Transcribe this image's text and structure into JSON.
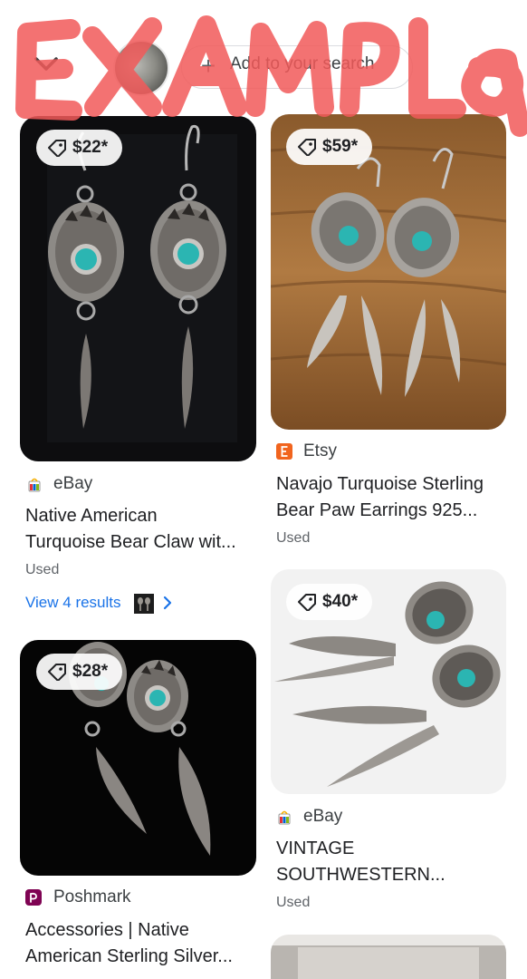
{
  "header": {
    "add_search_label": "Add to your search",
    "watermark": "EXAMPLE",
    "watermark_color": "#f25a5a"
  },
  "results": [
    {
      "price": "$22*",
      "store": "eBay",
      "title_line1": "Native American",
      "title_line2": "Turquoise Bear Claw wit...",
      "condition": "Used",
      "view_more": "View 4 results"
    },
    {
      "price": "$59*",
      "store": "Etsy",
      "title_line1": "Navajo Turquoise Sterling",
      "title_line2": "Bear Paw Earrings 925...",
      "condition": "Used"
    },
    {
      "price": "$40*",
      "store": "eBay",
      "title_line1": "VINTAGE",
      "title_line2": "SOUTHWESTERN...",
      "condition": "Used"
    },
    {
      "price": "$28*",
      "store": "Poshmark",
      "title_line1": "Accessories | Native",
      "title_line2": "American Sterling Silver..."
    }
  ],
  "colors": {
    "link": "#1a73e8",
    "etsy": "#f1641e",
    "poshmark": "#7f0353",
    "turquoise": "#2bb5b2"
  }
}
